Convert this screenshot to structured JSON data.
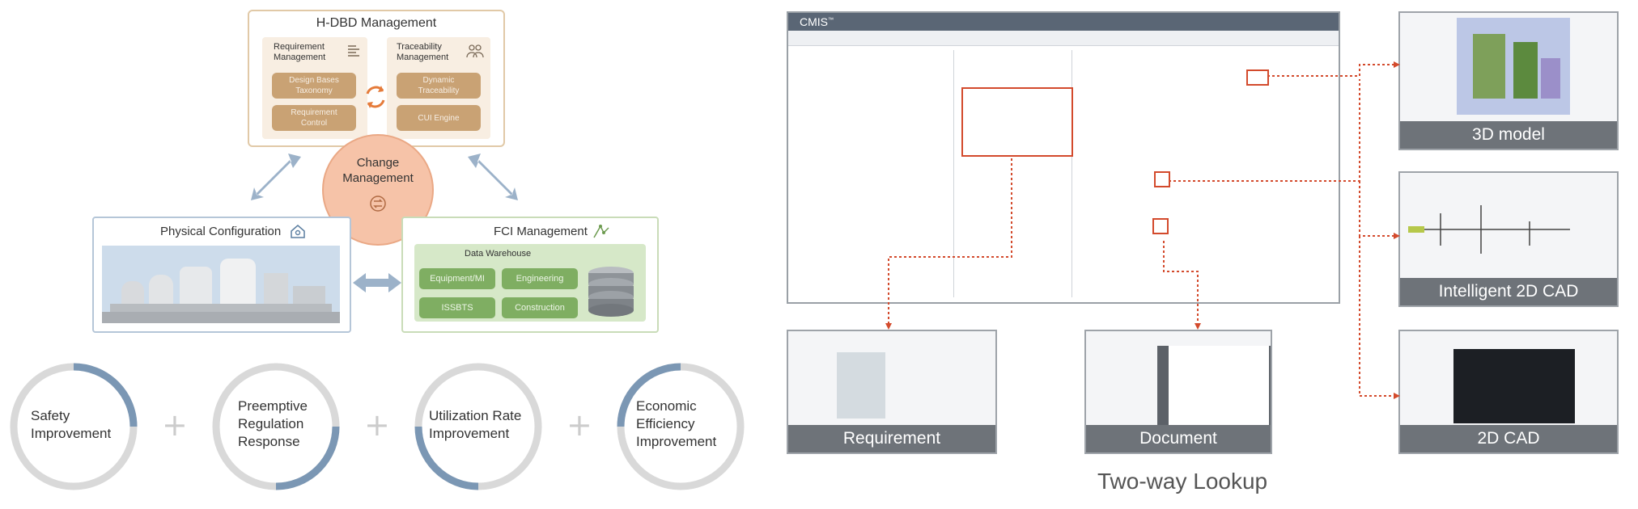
{
  "left": {
    "hdbd": {
      "title": "H-DBD Management",
      "requirement_mgmt": "Requirement\nManagement",
      "traceability_mgmt": "Traceability\nManagement",
      "design_bases_taxonomy": "Design Bases\nTaxonomy",
      "requirement_control": "Requirement\nControl",
      "dynamic_traceability": "Dynamic\nTraceability",
      "cui_engine": "CUI Engine"
    },
    "change_management": "Change\nManagement",
    "physical_config": {
      "title": "Physical Configuration"
    },
    "fci": {
      "title": "FCI Management",
      "warehouse_title": "Data Warehouse",
      "equipment": "Equipment/MI",
      "engineering": "Engineering",
      "operations": "ISSBTS",
      "construction": "Construction"
    },
    "benefits": [
      {
        "label": "Safety\nImprovement"
      },
      {
        "label": "Preemptive\nRegulation\nResponse"
      },
      {
        "label": "Utilization Rate\nImprovement"
      },
      {
        "label": "Economic\nEfficiency\nImprovement"
      }
    ],
    "plus": "+"
  },
  "right": {
    "app_title": "CMIS",
    "app_title_sup": "™",
    "shots": {
      "model3d": "3D model",
      "intelligent_cad": "Intelligent 2D CAD",
      "cad2d": "2D CAD",
      "requirement": "Requirement",
      "document": "Document"
    },
    "caption": "Two-way Lookup"
  },
  "colors": {
    "tan_box": "#c9a274",
    "tan_border": "#e1c9a7",
    "change_circle": "#f6c3a8",
    "green_box": "#7fae62",
    "green_bg": "#d6e8c8",
    "ring_gray": "#d9d9d9",
    "ring_blue": "#7b97b4",
    "lookup_red": "#d34a2c",
    "arrow_blue": "#9cb2c9"
  }
}
